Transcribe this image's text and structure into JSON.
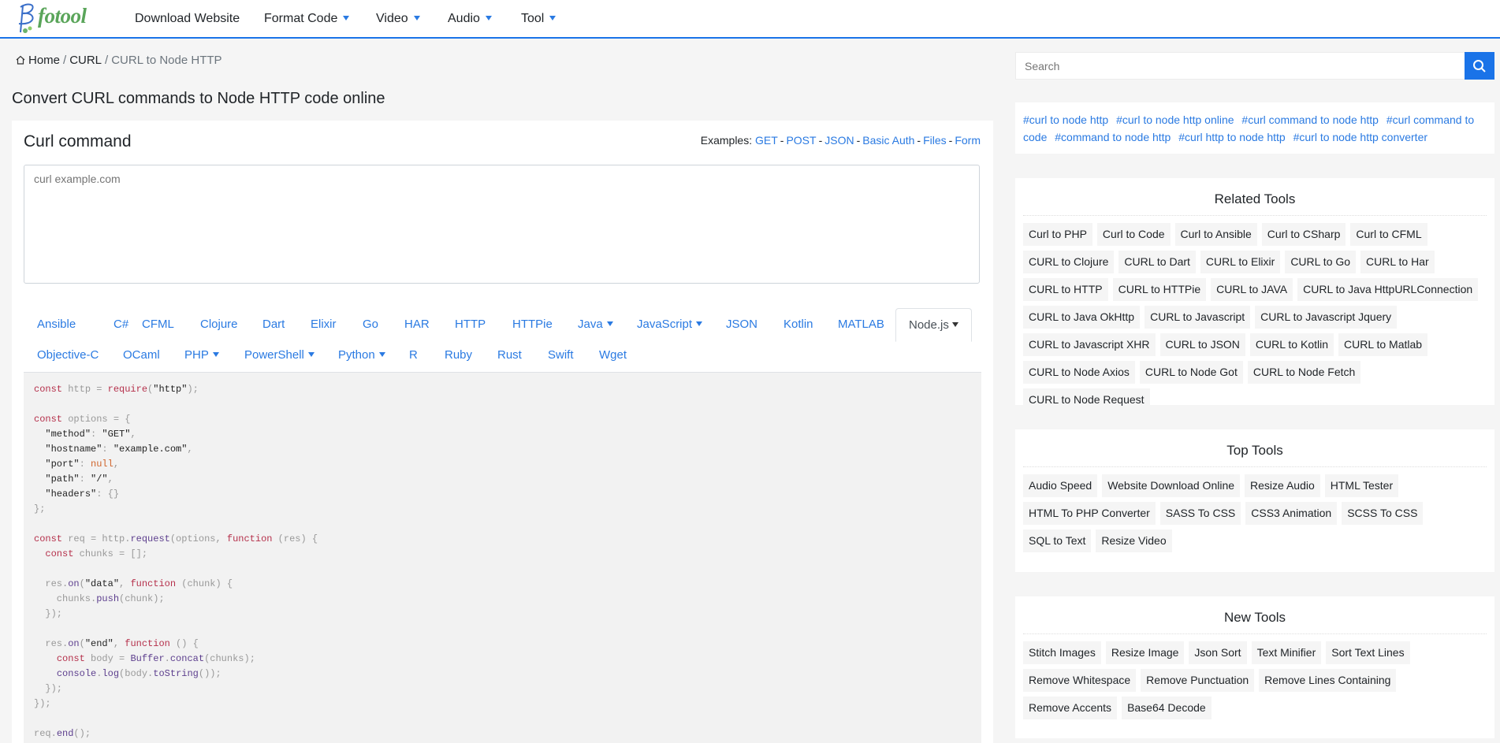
{
  "brand": {
    "logo_text": "fotool"
  },
  "nav": {
    "items": [
      {
        "label": "Download Website",
        "dropdown": false
      },
      {
        "label": "Format Code",
        "dropdown": true
      },
      {
        "label": "Video",
        "dropdown": true
      },
      {
        "label": "Audio",
        "dropdown": true
      },
      {
        "label": "Tool",
        "dropdown": true
      }
    ]
  },
  "breadcrumb": {
    "home": "Home",
    "sep": "/",
    "section": "CURL",
    "current": "CURL to Node HTTP"
  },
  "page_title": "Convert CURL commands to Node HTTP code online",
  "curl": {
    "title": "Curl command",
    "examples_label": "Examples:",
    "examples": [
      "GET",
      "POST",
      "JSON",
      "Basic Auth",
      "Files",
      "Form"
    ],
    "placeholder": "curl example.com"
  },
  "tabs": {
    "row1": [
      "Ansible",
      "C#",
      "CFML",
      "Clojure",
      "Dart",
      "Elixir",
      "Go",
      "HAR",
      "HTTP",
      "HTTPie",
      "Java",
      "JavaScript",
      "JSON",
      "Kotlin",
      "MATLAB",
      "Node.js"
    ],
    "row2": [
      "Objective-C",
      "OCaml",
      "PHP",
      "PowerShell",
      "Python",
      "R",
      "Ruby",
      "Rust",
      "Swift",
      "Wget"
    ],
    "active": "Node.js"
  },
  "search": {
    "placeholder": "Search",
    "icon": "search-icon"
  },
  "tags": [
    "#curl to node http",
    "#curl to node http online",
    "#curl command to node http",
    "#curl command to code",
    "#command to node http",
    "#curl http to node http",
    "#curl to node http converter"
  ],
  "related": {
    "title": "Related Tools",
    "items": [
      "Curl to PHP",
      "Curl to Code",
      "Curl to Ansible",
      "Curl to CSharp",
      "Curl to CFML",
      "CURL to Clojure",
      "CURL to Dart",
      "CURL to Elixir",
      "CURL to Go",
      "CURL to Har",
      "CURL to HTTP",
      "CURL to HTTPie",
      "CURL to JAVA",
      "CURL to Java HttpURLConnection",
      "CURL to Java OkHttp",
      "CURL to Javascript",
      "CURL to Javascript Jquery",
      "CURL to Javascript XHR",
      "CURL to JSON",
      "CURL to Kotlin",
      "CURL to Matlab",
      "CURL to Node Axios",
      "CURL to Node Got",
      "CURL to Node Fetch",
      "CURL to Node Request"
    ]
  },
  "top": {
    "title": "Top Tools",
    "items": [
      "Audio Speed",
      "Website Download Online",
      "Resize Audio",
      "HTML Tester",
      "HTML To PHP Converter",
      "SASS To CSS",
      "CSS3 Animation",
      "SCSS To CSS",
      "SQL to Text",
      "Resize Video"
    ]
  },
  "new": {
    "title": "New Tools",
    "items": [
      "Stitch Images",
      "Resize Image",
      "Json Sort",
      "Text Minifier",
      "Sort Text Lines",
      "Remove Whitespace",
      "Remove Punctuation",
      "Remove Lines Containing",
      "Remove Accents",
      "Base64 Decode"
    ]
  },
  "colors": {
    "accent": "#1a73e8",
    "link": "#2a7ae2",
    "brand_green": "#5aa55a"
  }
}
